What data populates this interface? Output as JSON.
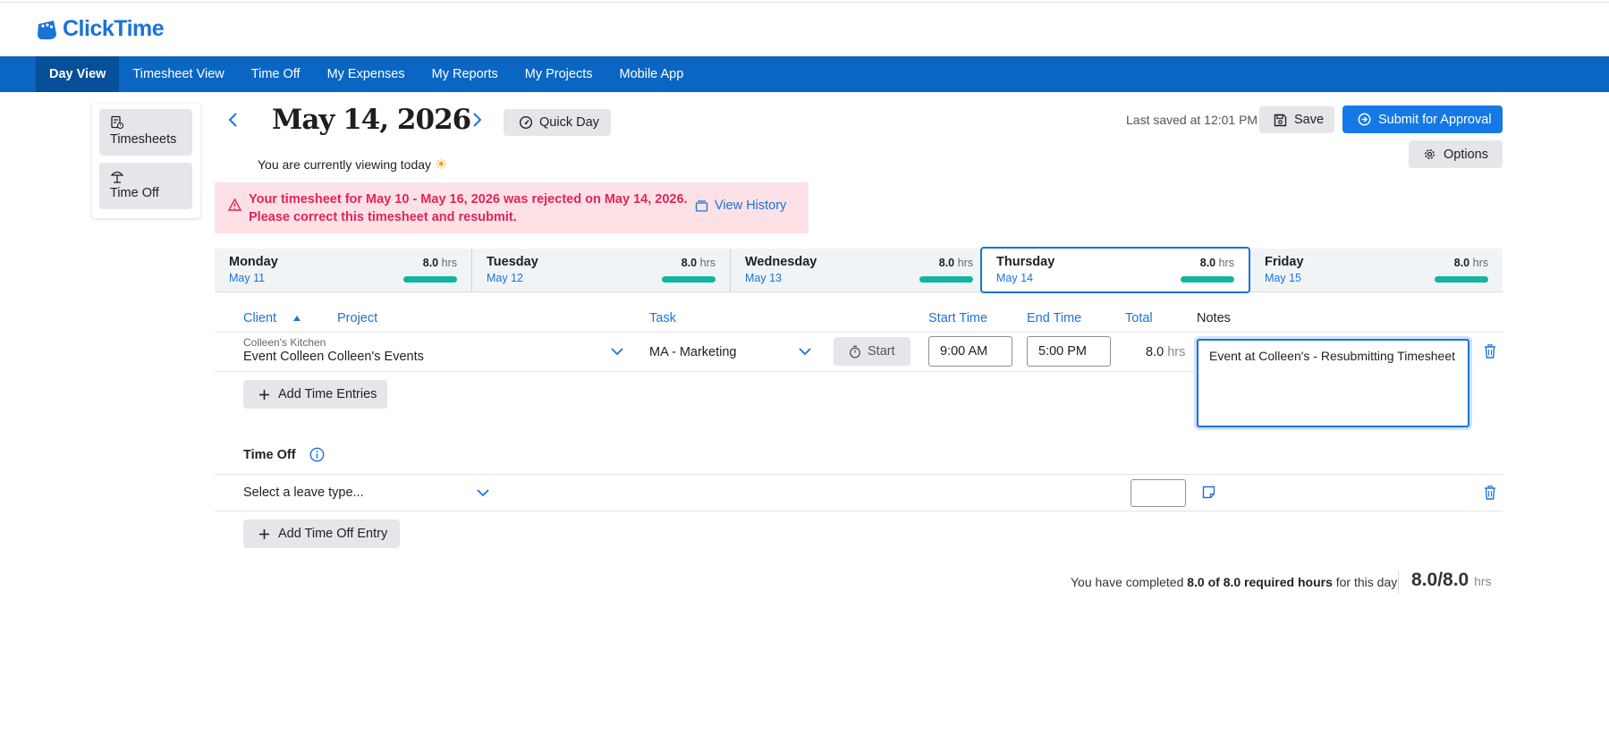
{
  "app": {
    "logo_text": "ClickTime",
    "brand_color": "#1a73d9",
    "nav_color": "#0a66c2"
  },
  "nav": {
    "items": [
      "Day View",
      "Timesheet View",
      "Time Off",
      "My Expenses",
      "My Reports",
      "My Projects",
      "Mobile App"
    ],
    "active": "Day View"
  },
  "sidebar": {
    "timesheets_label": "Timesheets",
    "timeoff_label": "Time Off"
  },
  "header": {
    "date_title": "May 14, 2026",
    "quick_day_label": "Quick Day",
    "today_note": "You are currently viewing today",
    "last_saved": "Last saved at 12:01 PM",
    "save_label": "Save",
    "submit_label": "Submit for Approval",
    "options_label": "Options"
  },
  "alert": {
    "line1": "Your timesheet for May 10 - May 16, 2026 was rejected on May 14, 2026.",
    "line2": "Please correct this timesheet and resubmit.",
    "view_history_label": "View History",
    "color": "#e0245e"
  },
  "days": [
    {
      "name": "Monday",
      "date": "May 11",
      "hours": "8.0",
      "unit": "hrs",
      "progress": 1.0
    },
    {
      "name": "Tuesday",
      "date": "May 12",
      "hours": "8.0",
      "unit": "hrs",
      "progress": 1.0
    },
    {
      "name": "Wednesday",
      "date": "May 13",
      "hours": "8.0",
      "unit": "hrs",
      "progress": 1.0
    },
    {
      "name": "Thursday",
      "date": "May 14",
      "hours": "8.0",
      "unit": "hrs",
      "progress": 1.0
    },
    {
      "name": "Friday",
      "date": "May 15",
      "hours": "8.0",
      "unit": "hrs",
      "progress": 1.0
    }
  ],
  "columns": {
    "client": "Client",
    "project": "Project",
    "task": "Task",
    "start": "Start Time",
    "end": "End Time",
    "total": "Total",
    "notes": "Notes"
  },
  "entry": {
    "client_small": "Colleen's Kitchen",
    "client_main": "Event Colleen Colleen's Events",
    "task": "MA - Marketing",
    "start_btn": "Start",
    "start_time": "9:00 AM",
    "end_time": "5:00 PM",
    "total": "8.0",
    "total_unit": "hrs",
    "notes": "Event at Colleen's - Resubmitting Timesheet"
  },
  "add_time_entries_label": "Add Time Entries",
  "time_off": {
    "title": "Time Off",
    "leave_placeholder": "Select a leave type...",
    "add_label": "Add Time Off Entry"
  },
  "footer": {
    "completed_prefix": "You have completed",
    "completed_bold": "8.0 of 8.0 required hours",
    "completed_suffix": "for this day",
    "day_total": "8.0/8.0",
    "day_total_unit": "hrs"
  }
}
